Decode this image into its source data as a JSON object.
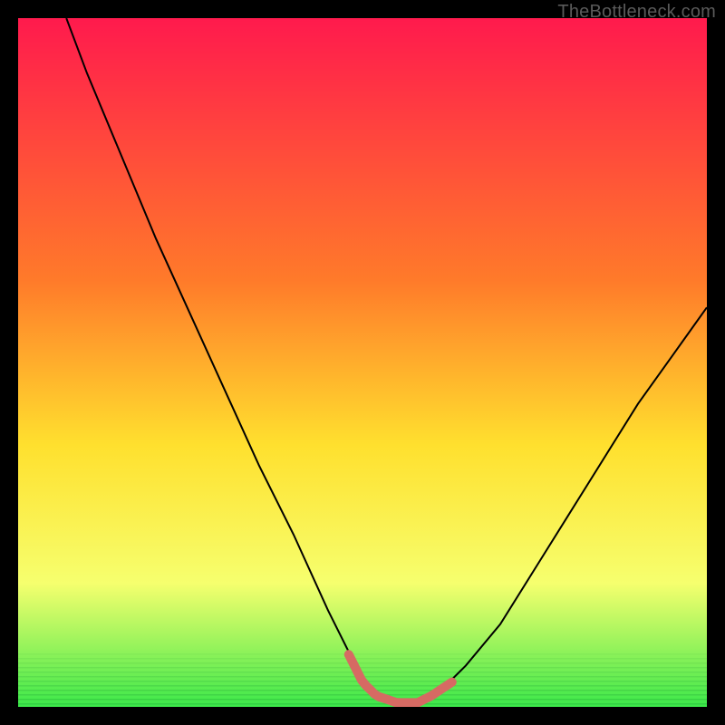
{
  "watermark": "TheBottleneck.com",
  "colors": {
    "bg": "#000000",
    "curve": "#000000",
    "accent": "#d66a63",
    "green": "#28e65b",
    "grad_top": "#ff1a4d",
    "grad_mid1": "#ff7a2a",
    "grad_mid2": "#ffe02e",
    "grad_mid3": "#f6ff6e",
    "grad_bot": "#3CE84A"
  },
  "chart_data": {
    "type": "line",
    "title": "",
    "xlabel": "",
    "ylabel": "",
    "xlim": [
      0,
      100
    ],
    "ylim": [
      0,
      100
    ],
    "x": [
      7,
      10,
      15,
      20,
      25,
      30,
      35,
      40,
      45,
      48,
      50,
      52,
      55,
      58,
      60,
      63,
      65,
      70,
      75,
      80,
      85,
      90,
      95,
      100
    ],
    "series": [
      {
        "name": "bottleneck-curve",
        "values": [
          100,
          92,
          80,
          68,
          57,
          46,
          35,
          25,
          14,
          8,
          4,
          2,
          1,
          1,
          2,
          4,
          6,
          12,
          20,
          28,
          36,
          44,
          51,
          58
        ]
      }
    ],
    "accent_segment": {
      "x_start": 48,
      "x_end": 63
    }
  }
}
